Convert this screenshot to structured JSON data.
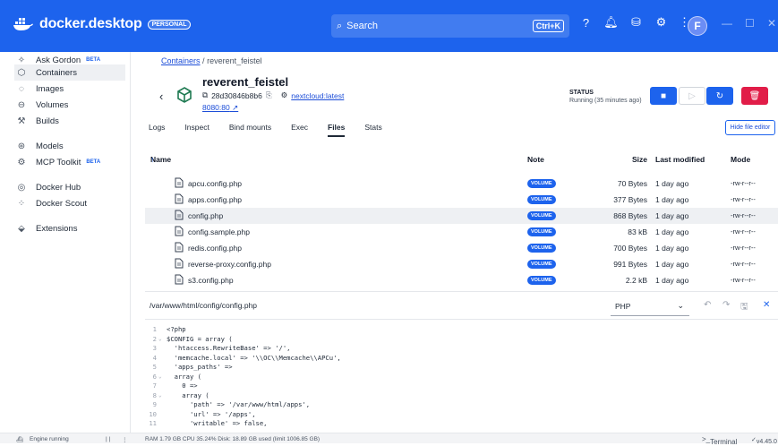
{
  "app": {
    "title": "docker.desktop",
    "badge": "PERSONAL"
  },
  "search": {
    "placeholder": "Search",
    "shortcut": "Ctrl+K"
  },
  "user": {
    "initial": "F"
  },
  "sidebar": {
    "items": [
      {
        "label": "Ask Gordon",
        "badge": "BETA",
        "icon": "sparkle-icon"
      },
      {
        "label": "Containers",
        "icon": "container-icon"
      },
      {
        "label": "Images",
        "icon": "images-icon"
      },
      {
        "label": "Volumes",
        "icon": "volume-icon"
      },
      {
        "label": "Builds",
        "icon": "builds-icon"
      },
      {
        "label": "Models",
        "icon": "models-icon"
      },
      {
        "label": "MCP Toolkit",
        "badge": "BETA",
        "icon": "toolkit-icon"
      },
      {
        "label": "Docker Hub",
        "icon": "hub-icon"
      },
      {
        "label": "Docker Scout",
        "icon": "scout-icon"
      },
      {
        "label": "Extensions",
        "icon": "extensions-icon"
      }
    ]
  },
  "breadcrumb": {
    "root": "Containers",
    "sep": "/",
    "current": "reverent_feistel"
  },
  "container": {
    "name": "reverent_feistel",
    "id": "28d30846b8b6",
    "image": "nextcloud:latest",
    "port": "8080:80"
  },
  "status": {
    "label": "STATUS",
    "value": "Running (35 minutes ago)"
  },
  "tabs": [
    "Logs",
    "Inspect",
    "Bind mounts",
    "Exec",
    "Files",
    "Stats"
  ],
  "hide_file_editor": "Hide file editor",
  "table": {
    "headers": {
      "name": "Name",
      "note": "Note",
      "size": "Size",
      "modified": "Last modified",
      "mode": "Mode"
    },
    "rows": [
      {
        "name": "apcu.config.php",
        "note": "VOLUME",
        "size": "70 Bytes",
        "modified": "1 day ago",
        "mode": "-rw-r--r--"
      },
      {
        "name": "apps.config.php",
        "note": "VOLUME",
        "size": "377 Bytes",
        "modified": "1 day ago",
        "mode": "-rw-r--r--"
      },
      {
        "name": "config.php",
        "note": "VOLUME",
        "size": "868 Bytes",
        "modified": "1 day ago",
        "mode": "-rw-r--r--"
      },
      {
        "name": "config.sample.php",
        "note": "VOLUME",
        "size": "83 kB",
        "modified": "1 day ago",
        "mode": "-rw-r--r--"
      },
      {
        "name": "redis.config.php",
        "note": "VOLUME",
        "size": "700 Bytes",
        "modified": "1 day ago",
        "mode": "-rw-r--r--"
      },
      {
        "name": "reverse-proxy.config.php",
        "note": "VOLUME",
        "size": "991 Bytes",
        "modified": "1 day ago",
        "mode": "-rw-r--r--"
      },
      {
        "name": "s3.config.php",
        "note": "VOLUME",
        "size": "2.2 kB",
        "modified": "1 day ago",
        "mode": "-rw-r--r--"
      }
    ]
  },
  "editor": {
    "path": "/var/www/html/config/config.php",
    "language": "PHP",
    "lines": [
      {
        "n": "1",
        "fold": "",
        "text": "<?php"
      },
      {
        "n": "2",
        "fold": "⌄",
        "text": "$CONFIG = array ("
      },
      {
        "n": "3",
        "fold": "",
        "text": "  'htaccess.RewriteBase' => '/',"
      },
      {
        "n": "4",
        "fold": "",
        "text": "  'memcache.local' => '\\\\OC\\\\Memcache\\\\APCu',"
      },
      {
        "n": "5",
        "fold": "",
        "text": "  'apps_paths' =>"
      },
      {
        "n": "6",
        "fold": "⌄",
        "text": "  array ("
      },
      {
        "n": "7",
        "fold": "",
        "text": "    0 =>"
      },
      {
        "n": "8",
        "fold": "⌄",
        "text": "    array ("
      },
      {
        "n": "9",
        "fold": "",
        "text": "      'path' => '/var/www/html/apps',"
      },
      {
        "n": "10",
        "fold": "",
        "text": "      'url' => '/apps',"
      },
      {
        "n": "11",
        "fold": "",
        "text": "      'writable' => false,"
      }
    ]
  },
  "footer": {
    "engine": "Engine running",
    "stats": "RAM 1.79 GB  CPU 35.24%  Disk: 18.89 GB used (limit 1006.85 GB)",
    "terminal": "Terminal",
    "version": "v4.45.0"
  },
  "colors": {
    "brand": "#1d63ed",
    "danger": "#e11d48"
  }
}
